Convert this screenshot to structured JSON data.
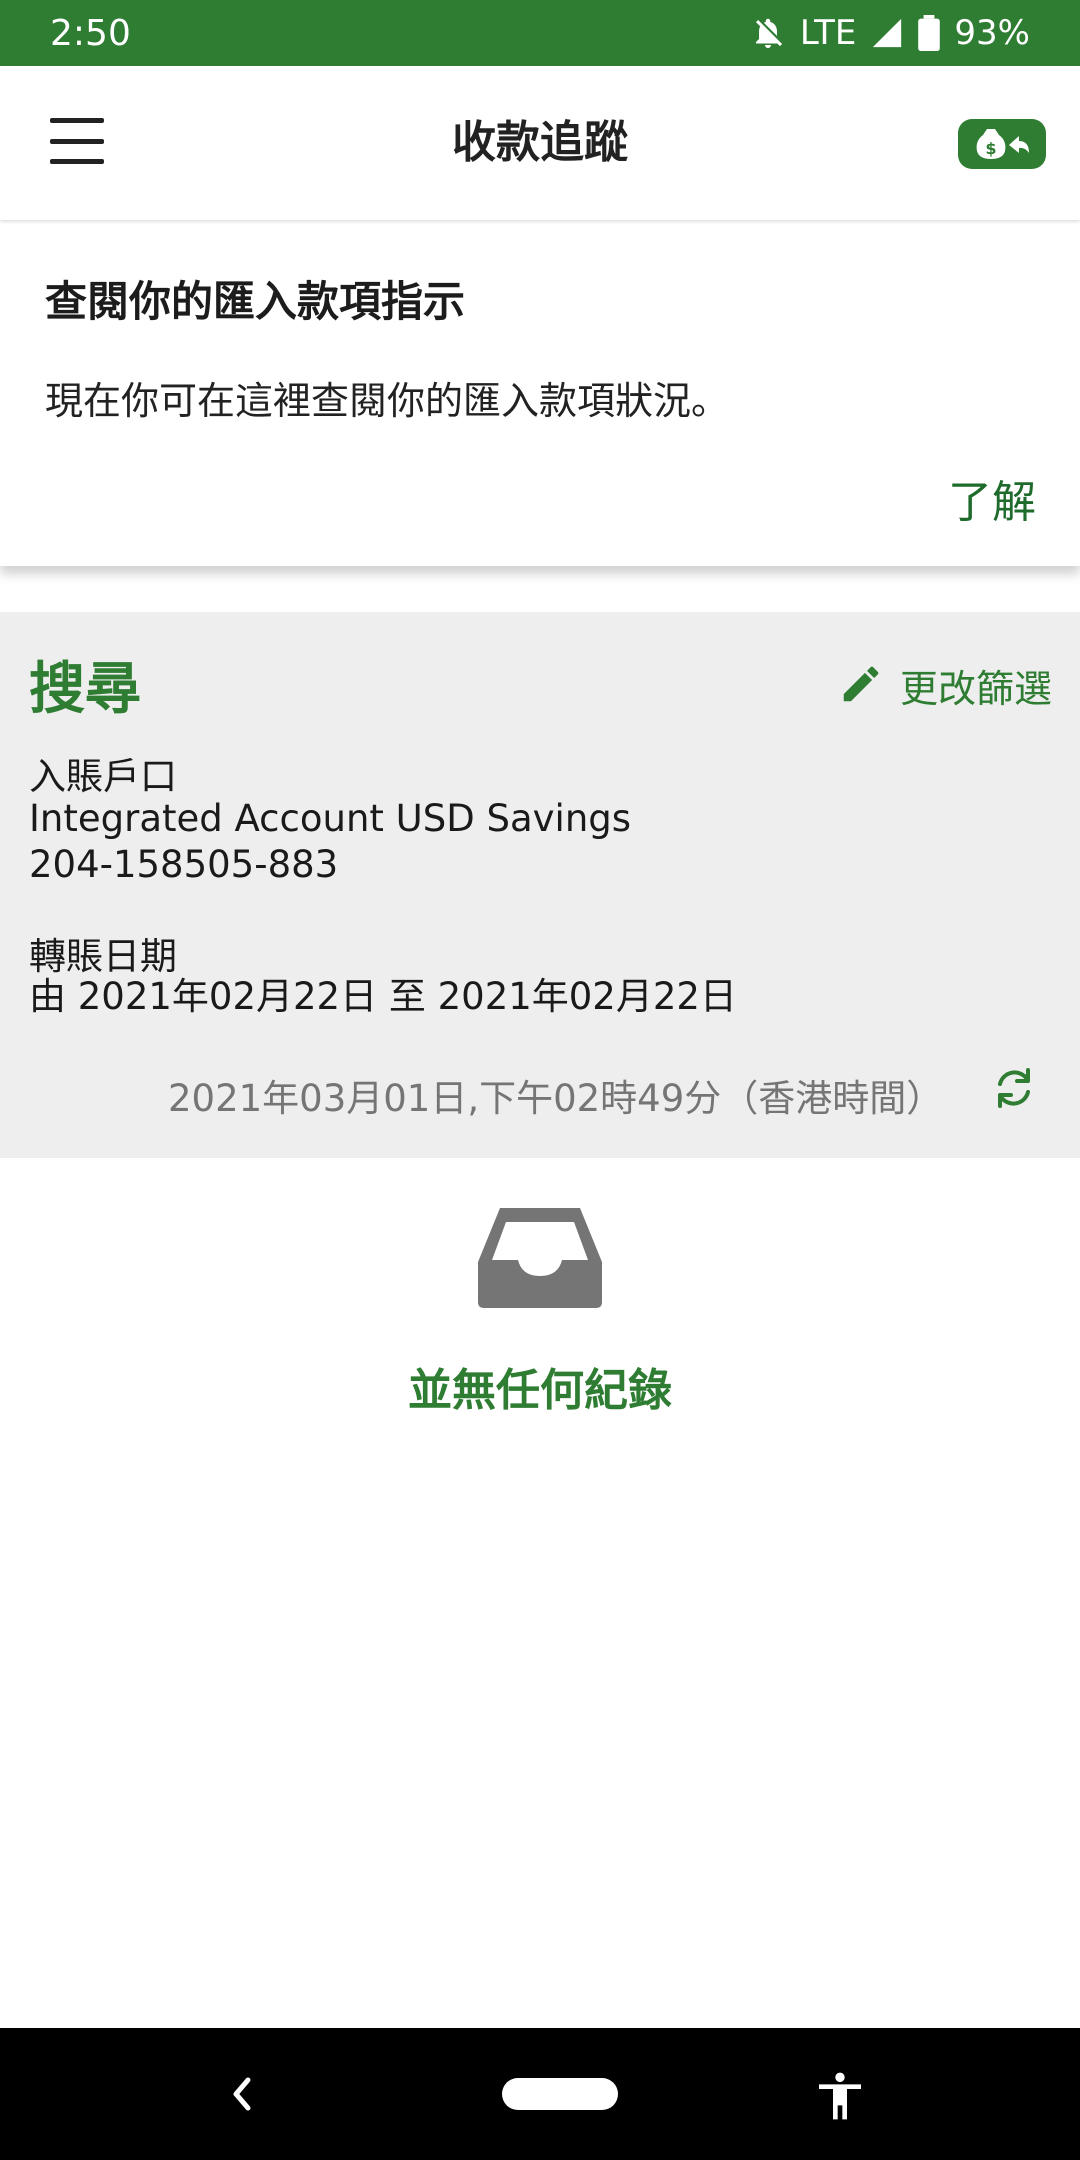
{
  "status_bar": {
    "time": "2:50",
    "network": "LTE",
    "battery": "93%",
    "icons": [
      "notifications-off-icon",
      "signal-icon",
      "battery-icon"
    ]
  },
  "app_bar": {
    "title": "收款追蹤",
    "menu_icon": "hamburger-menu-icon",
    "badge_icon": "money-bag-return-icon"
  },
  "info_card": {
    "title": "查閱你的匯入款項指示",
    "text": "現在你可在這裡查閱你的匯入款項狀況。",
    "ok_label": "了解"
  },
  "search": {
    "heading": "搜尋",
    "edit_filter_label": "更改篩選",
    "account_label": "入賬戶口",
    "account_name": "Integrated Account USD Savings",
    "account_number": "204-158505-883",
    "date_label": "轉賬日期",
    "date_range": "由 2021年02月22日 至 2021年02月22日",
    "timestamp": "2021年03月01日,下午02時49分（香港時間）"
  },
  "empty_state": {
    "icon": "inbox-tray-icon",
    "text": "並無任何紀錄"
  },
  "colors": {
    "brand_green": "#2e7d32",
    "status_bar": "#2e7d32",
    "section_bg": "#eeeeee",
    "muted_text": "#757575"
  }
}
